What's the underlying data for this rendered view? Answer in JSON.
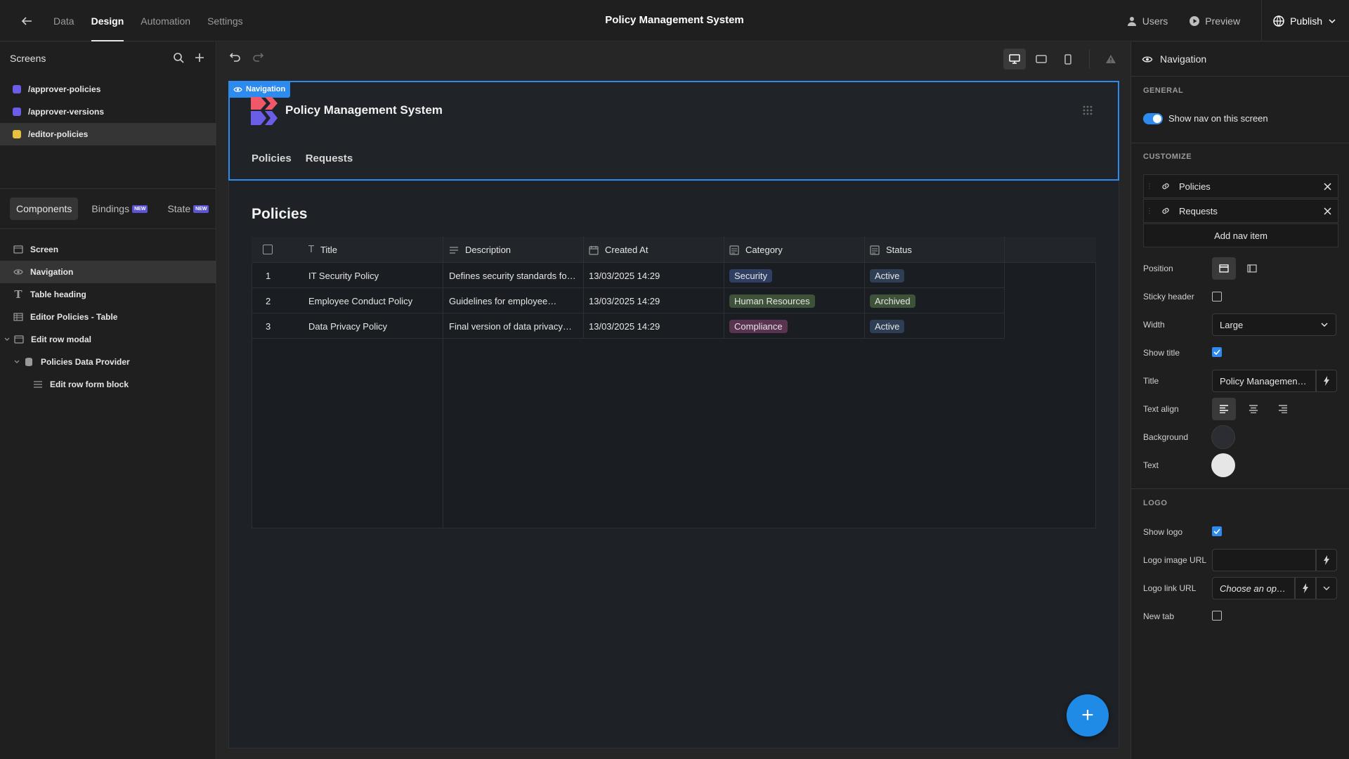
{
  "topbar": {
    "nav": [
      "Data",
      "Design",
      "Automation",
      "Settings"
    ],
    "active": "Design",
    "app_title": "Policy Management System",
    "users_label": "Users",
    "preview_label": "Preview",
    "publish_label": "Publish"
  },
  "screens": {
    "header": "Screens",
    "routes": [
      {
        "path": "/approver-policies",
        "color": "#6a5de8"
      },
      {
        "path": "/approver-versions",
        "color": "#6a5de8"
      },
      {
        "path": "/editor-policies",
        "color": "#e8c040"
      }
    ]
  },
  "left_tabs": {
    "components": "Components",
    "bindings": "Bindings",
    "state": "State",
    "new_badge": "NEW"
  },
  "tree": {
    "screen": "Screen",
    "navigation": "Navigation",
    "table_heading": "Table heading",
    "editor_table": "Editor Policies - Table",
    "edit_modal": "Edit row modal",
    "data_provider": "Policies Data Provider",
    "form_block": "Edit row form block"
  },
  "canvas": {
    "nav_tag": "Navigation",
    "nav_title": "Policy Management System",
    "nav_links": [
      "Policies",
      "Requests"
    ],
    "page_heading": "Policies",
    "columns": [
      "Title",
      "Description",
      "Created At",
      "Category",
      "Status"
    ],
    "rows": [
      {
        "n": "1",
        "title": "IT Security Policy",
        "desc": "Defines security standards fo…",
        "created": "13/03/2025 14:29",
        "category": "Security",
        "status": "Active"
      },
      {
        "n": "2",
        "title": "Employee Conduct Policy",
        "desc": "Guidelines for employee…",
        "created": "13/03/2025 14:29",
        "category": "Human Resources",
        "status": "Archived"
      },
      {
        "n": "3",
        "title": "Data Privacy Policy",
        "desc": "Final version of data privacy…",
        "created": "13/03/2025 14:29",
        "category": "Compliance",
        "status": "Active"
      }
    ],
    "fab": "+"
  },
  "settings": {
    "header": "Navigation",
    "general": "GENERAL",
    "show_nav": "Show nav on this screen",
    "customize": "CUSTOMIZE",
    "nav_items": [
      "Policies",
      "Requests"
    ],
    "add_nav": "Add nav item",
    "position": "Position",
    "sticky": "Sticky header",
    "width": "Width",
    "width_val": "Large",
    "show_title": "Show title",
    "title": "Title",
    "title_val": "Policy Managemen…",
    "text_align": "Text align",
    "background": "Background",
    "text": "Text",
    "logo": "LOGO",
    "show_logo": "Show logo",
    "logo_url": "Logo image URL",
    "logo_link": "Logo link URL",
    "logo_link_placeholder": "Choose an op…",
    "new_tab": "New tab",
    "colors": {
      "background": "#2b2d33",
      "text": "#e6e6e6",
      "accent": "#2d8bf0"
    }
  }
}
